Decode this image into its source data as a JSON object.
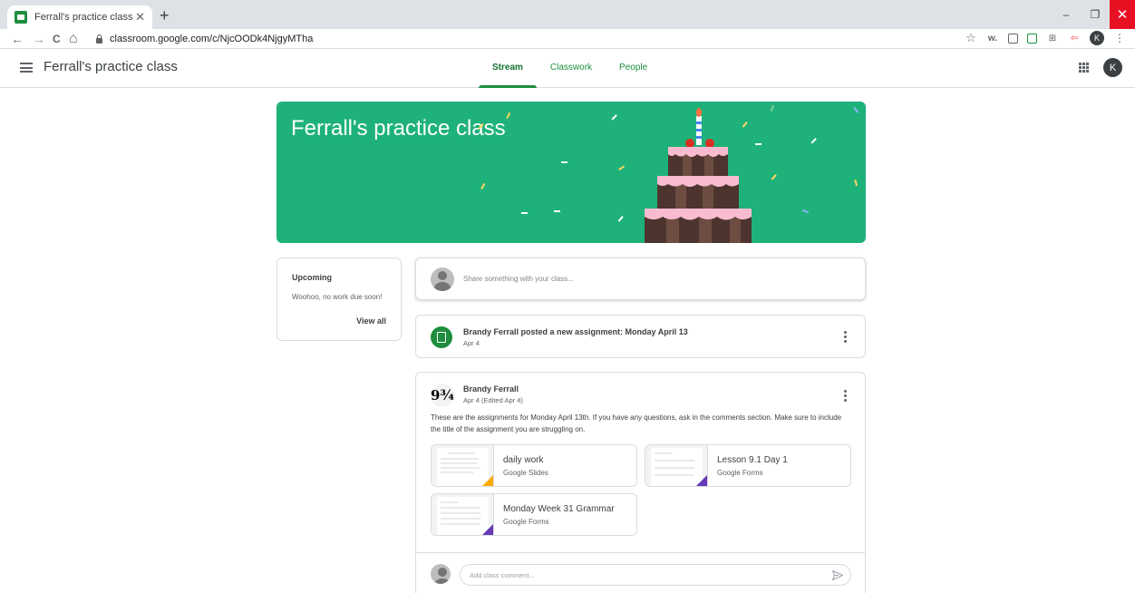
{
  "browser": {
    "tab_title": "Ferrall's practice class",
    "tab_close": "✕",
    "new_tab": "+",
    "url": "classroom.google.com/c/NjcOODk4NjgyMTha",
    "profile_initial": "K",
    "ext_w": "w.",
    "ext_grid": "⊞",
    "ext_arrow": "⇦",
    "star": "☆",
    "more": "⋮",
    "back": "←",
    "forward": "→",
    "reload": "C",
    "home": "⌂",
    "minimize": "–",
    "restore": "❐",
    "close": "✕"
  },
  "header": {
    "class_name": "Ferrall's practice class",
    "tabs": [
      {
        "label": "Stream",
        "active": true
      },
      {
        "label": "Classwork",
        "active": false
      },
      {
        "label": "People",
        "active": false
      }
    ],
    "avatar_initial": "K"
  },
  "banner": {
    "title": "Ferrall's practice class",
    "color": "#1eb27a"
  },
  "upcoming": {
    "title": "Upcoming",
    "message": "Woohoo, no work due soon!",
    "view_all": "View all"
  },
  "share": {
    "placeholder": "Share something with your class..."
  },
  "assignment_post": {
    "title": "Brandy Ferrall posted a new assignment: Monday April 13",
    "date": "Apr 4"
  },
  "post": {
    "avatar_text": "9¾",
    "author": "Brandy Ferrall",
    "date": "Apr 4 (Edited Apr 4)",
    "body": "These are the assignments for Monday April 13th. If you have any questions, ask in the comments section. Make sure to include the title of the assignment you are struggling on.",
    "attachments": [
      {
        "title": "daily work",
        "type": "Google Slides",
        "accent": "#f9ab00"
      },
      {
        "title": "Lesson 9.1 Day 1",
        "type": "Google Forms",
        "accent": "#673ab7"
      },
      {
        "title": "Monday Week 31 Grammar",
        "type": "Google Forms",
        "accent": "#673ab7"
      }
    ],
    "comment_placeholder": "Add class comment..."
  }
}
